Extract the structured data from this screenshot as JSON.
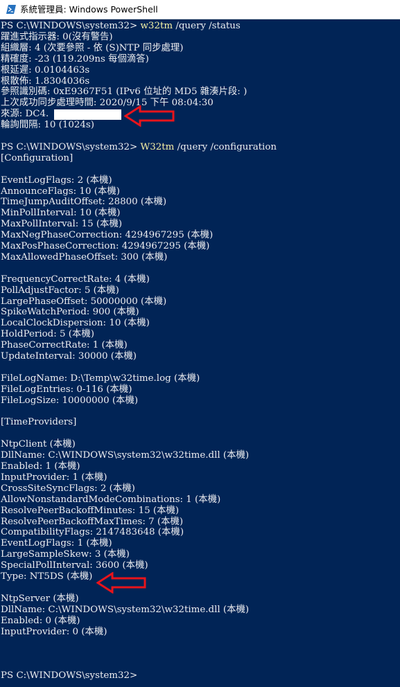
{
  "window": {
    "title": "系統管理員: Windows PowerShell"
  },
  "console": {
    "lines": [
      {
        "prompt": "PS C:\\WINDOWS\\system32> ",
        "command": "w32tm",
        "args": " /query /status"
      },
      {
        "text": "躍進式指示器: 0(沒有警告)"
      },
      {
        "text": "組織層: 4 (次要參照 - 依 (S)NTP 同步處理)"
      },
      {
        "text": "精確度: -23 (119.209ns 每個滴答)"
      },
      {
        "text": "根延遲: 0.0104463s"
      },
      {
        "text": "根散佈: 1.8304036s"
      },
      {
        "text": "參照識別碼: 0xE9367F51 (IPv6 位址的 MD5 雜湊片段: )"
      },
      {
        "text": "上次成功同步處理時間: 2020/9/15 下午 08:04:30"
      },
      {
        "text": "來源: DC4."
      },
      {
        "text": "輪詢間隔: 10 (1024s)"
      },
      {
        "text": ""
      },
      {
        "prompt": "PS C:\\WINDOWS\\system32> ",
        "command": "W32tm",
        "args": " /query /configuration"
      },
      {
        "text": "[Configuration]"
      },
      {
        "text": ""
      },
      {
        "text": "EventLogFlags: 2 (本機)"
      },
      {
        "text": "AnnounceFlags: 10 (本機)"
      },
      {
        "text": "TimeJumpAuditOffset: 28800 (本機)"
      },
      {
        "text": "MinPollInterval: 10 (本機)"
      },
      {
        "text": "MaxPollInterval: 15 (本機)"
      },
      {
        "text": "MaxNegPhaseCorrection: 4294967295 (本機)"
      },
      {
        "text": "MaxPosPhaseCorrection: 4294967295 (本機)"
      },
      {
        "text": "MaxAllowedPhaseOffset: 300 (本機)"
      },
      {
        "text": ""
      },
      {
        "text": "FrequencyCorrectRate: 4 (本機)"
      },
      {
        "text": "PollAdjustFactor: 5 (本機)"
      },
      {
        "text": "LargePhaseOffset: 50000000 (本機)"
      },
      {
        "text": "SpikeWatchPeriod: 900 (本機)"
      },
      {
        "text": "LocalClockDispersion: 10 (本機)"
      },
      {
        "text": "HoldPeriod: 5 (本機)"
      },
      {
        "text": "PhaseCorrectRate: 1 (本機)"
      },
      {
        "text": "UpdateInterval: 30000 (本機)"
      },
      {
        "text": ""
      },
      {
        "text": "FileLogName: D:\\Temp\\w32time.log (本機)"
      },
      {
        "text": "FileLogEntries: 0-116 (本機)"
      },
      {
        "text": "FileLogSize: 10000000 (本機)"
      },
      {
        "text": ""
      },
      {
        "text": "[TimeProviders]"
      },
      {
        "text": ""
      },
      {
        "text": "NtpClient (本機)"
      },
      {
        "text": "DllName: C:\\WINDOWS\\system32\\w32time.dll (本機)"
      },
      {
        "text": "Enabled: 1 (本機)"
      },
      {
        "text": "InputProvider: 1 (本機)"
      },
      {
        "text": "CrossSiteSyncFlags: 2 (本機)"
      },
      {
        "text": "AllowNonstandardModeCombinations: 1 (本機)"
      },
      {
        "text": "ResolvePeerBackoffMinutes: 15 (本機)"
      },
      {
        "text": "ResolvePeerBackoffMaxTimes: 7 (本機)"
      },
      {
        "text": "CompatibilityFlags: 2147483648 (本機)"
      },
      {
        "text": "EventLogFlags: 1 (本機)"
      },
      {
        "text": "LargeSampleSkew: 3 (本機)"
      },
      {
        "text": "SpecialPollInterval: 3600 (本機)"
      },
      {
        "text": "Type: NT5DS (本機)"
      },
      {
        "text": ""
      },
      {
        "text": "NtpServer (本機)"
      },
      {
        "text": "DllName: C:\\WINDOWS\\system32\\w32time.dll (本機)"
      },
      {
        "text": "Enabled: 0 (本機)"
      },
      {
        "text": "InputProvider: 0 (本機)"
      },
      {
        "text": ""
      },
      {
        "text": ""
      },
      {
        "text": ""
      },
      {
        "prompt": "PS C:\\WINDOWS\\system32> "
      }
    ]
  },
  "colors": {
    "background": "#012456",
    "text": "#eeedf0",
    "command": "#f9f1a5",
    "annotation_arrow": "#e8141b",
    "redaction": "#ffffff"
  },
  "icons": {
    "title_icon": "powershell-icon",
    "annotation": "red-arrow-icon"
  }
}
